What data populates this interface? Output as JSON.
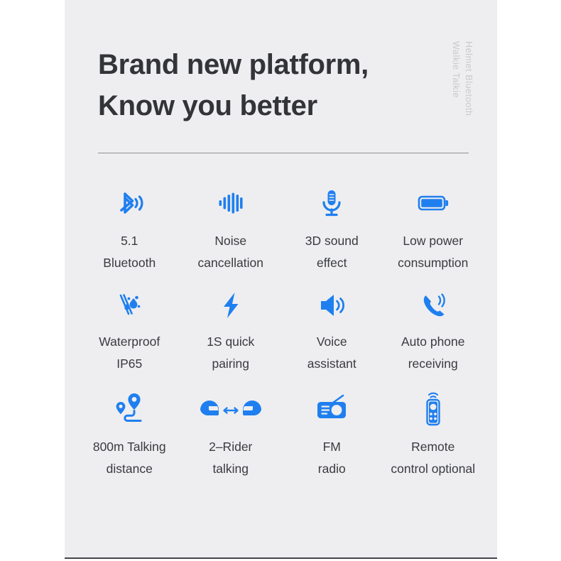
{
  "theme": {
    "page_background": "#ffffff",
    "card_background": "#eeeef0",
    "accent_blue": "#1f7fef",
    "headline_color": "#333438",
    "label_color": "#3a3b3f",
    "side_label_color": "#c9cacd",
    "divider_color": "#8e8f94"
  },
  "header": {
    "headline_line1": "Brand new platform,",
    "headline_line2": "Know you better",
    "side_text_line1": "Helmet Bluetooth",
    "side_text_line2": "Walkie Talkie"
  },
  "features": [
    {
      "icon": "bluetooth-icon",
      "line1": "5.1",
      "line2": "Bluetooth"
    },
    {
      "icon": "sound-wave-icon",
      "line1": "Noise",
      "line2": "cancellation"
    },
    {
      "icon": "microphone-icon",
      "line1": "3D sound",
      "line2": "effect"
    },
    {
      "icon": "battery-icon",
      "line1": "Low power",
      "line2": "consumption"
    },
    {
      "icon": "waterproof-icon",
      "line1": "Waterproof",
      "line2": "IP65"
    },
    {
      "icon": "lightning-bolt-icon",
      "line1": "1S quick",
      "line2": "pairing"
    },
    {
      "icon": "speaker-icon",
      "line1": "Voice",
      "line2": "assistant"
    },
    {
      "icon": "phone-call-icon",
      "line1": "Auto phone",
      "line2": "receiving"
    },
    {
      "icon": "map-route-icon",
      "line1": "800m Talking",
      "line2": "distance"
    },
    {
      "icon": "two-helmets-icon",
      "line1": "2–Rider",
      "line2": "talking"
    },
    {
      "icon": "radio-icon",
      "line1": "FM",
      "line2": "radio"
    },
    {
      "icon": "remote-control-icon",
      "line1": "Remote",
      "line2": "control optional"
    }
  ]
}
